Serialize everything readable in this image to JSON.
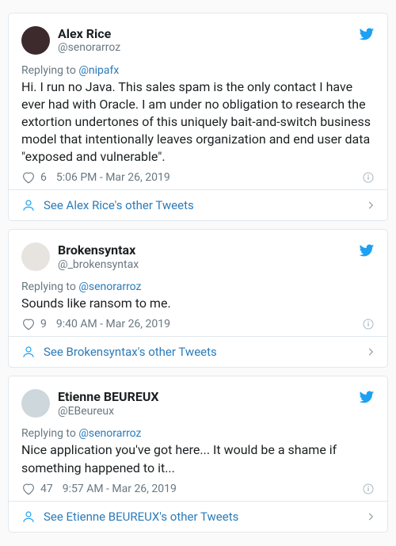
{
  "twitter_blue": "#1da1f2",
  "replying_prefix": "Replying to ",
  "tweets": [
    {
      "avatar_bg": "#3c2a2d",
      "display_name": "Alex Rice",
      "handle": "@senorarroz",
      "reply_to": "@nipafx",
      "body": "Hi. I run no Java. This sales spam is the only contact I have ever had with Oracle. I am under no obligation to research the extortion undertones of this uniquely bait-and-switch business model that intentionally leaves organization and end user data \"exposed and vulnerable\".",
      "likes": "6",
      "time": "5:06 PM - Mar 26, 2019",
      "footer": "See Alex Rice's other Tweets"
    },
    {
      "avatar_bg": "#e7e4df",
      "display_name": "Brokensyntax",
      "handle": "@_brokensyntax",
      "reply_to": "@senorarroz",
      "body": "Sounds like ransom to me.",
      "likes": "9",
      "time": "9:40 AM - Mar 26, 2019",
      "footer": "See Brokensyntax's other Tweets"
    },
    {
      "avatar_bg": "#cdd7dc",
      "display_name": "Etienne BEUREUX",
      "handle": "@EBeureux",
      "reply_to": "@senorarroz",
      "body": "Nice application you've got here... It would be a shame if something happened to it...",
      "likes": "47",
      "time": "9:57 AM - Mar 26, 2019",
      "footer": "See Etienne BEUREUX's other Tweets"
    }
  ]
}
